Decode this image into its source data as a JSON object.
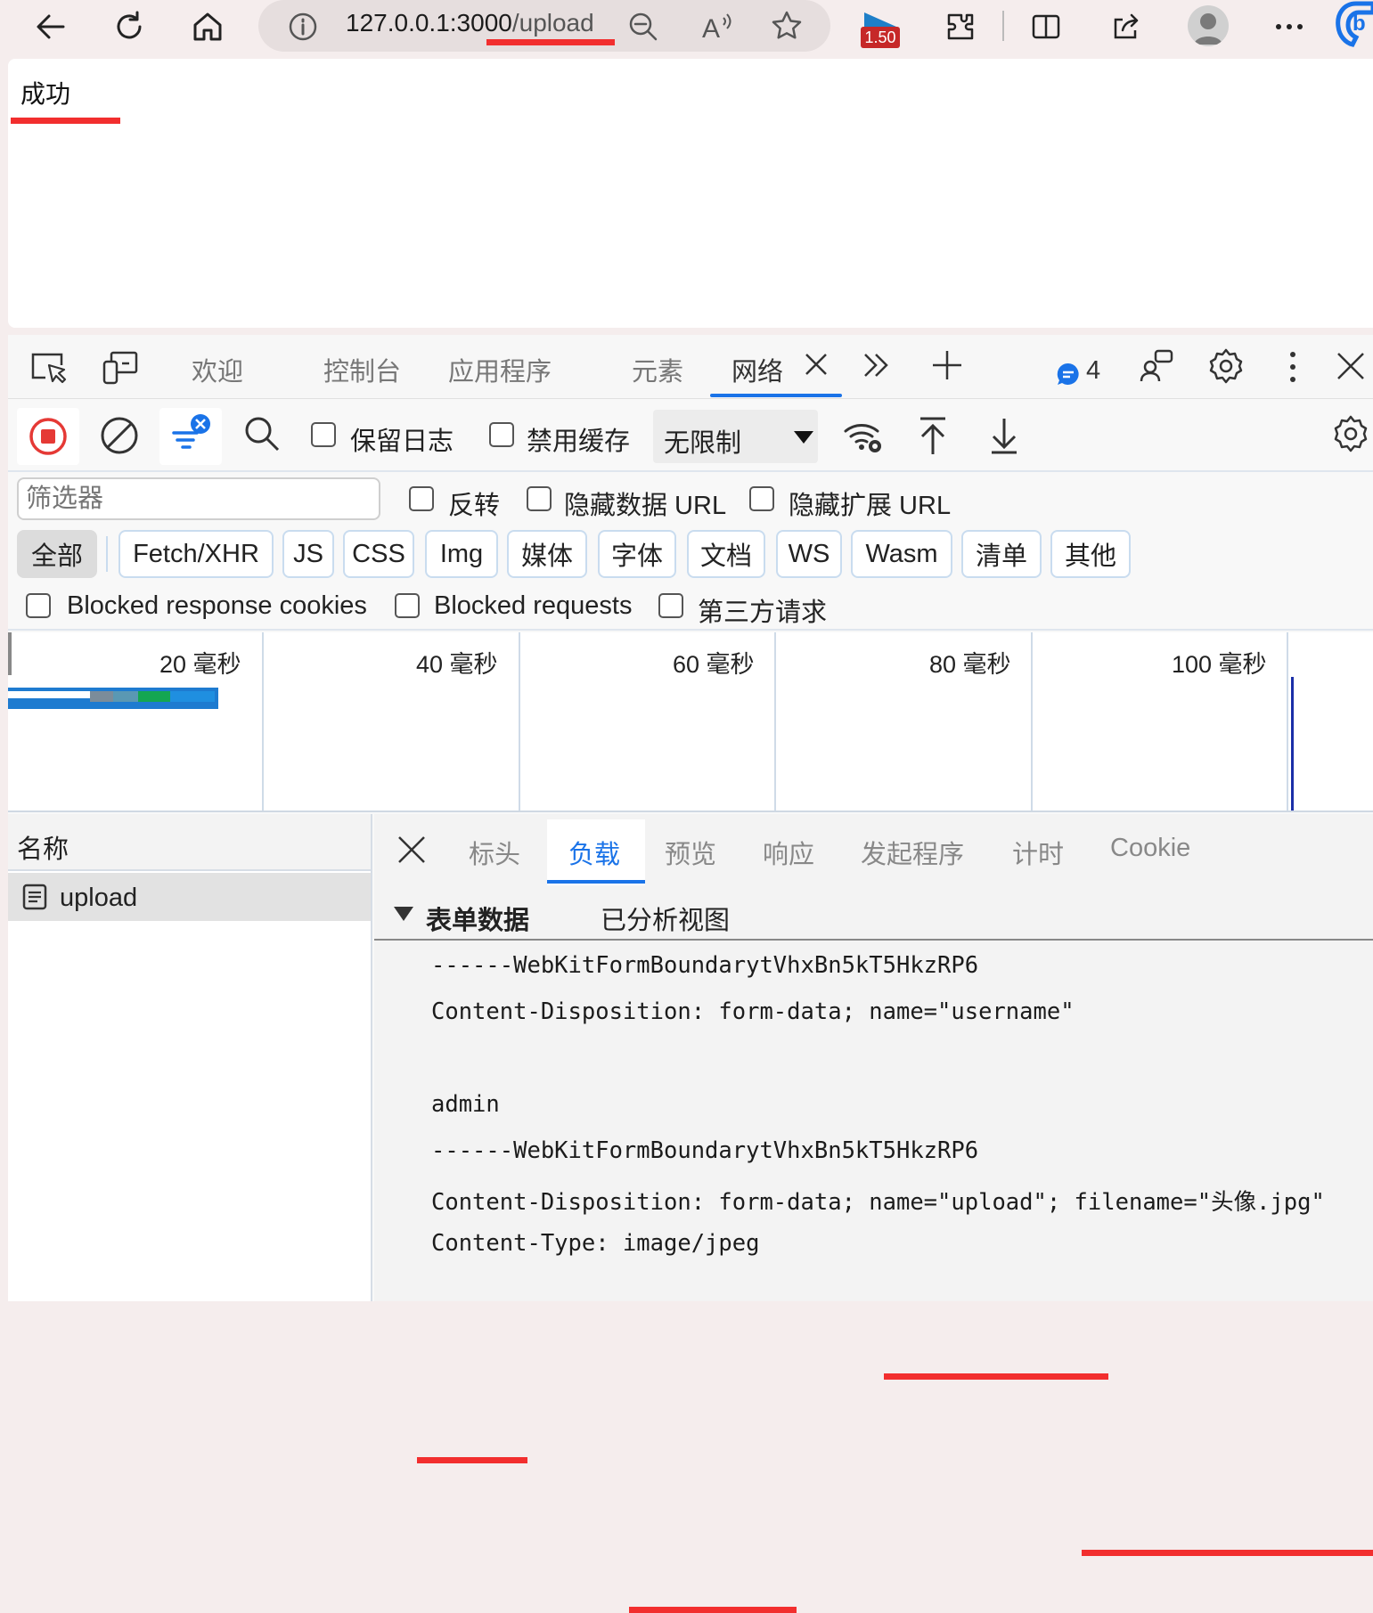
{
  "browser": {
    "url_host": "127.0.0.1:3000",
    "url_path": "/upload",
    "extension_badge": "1.50"
  },
  "page": {
    "text": "成功"
  },
  "devtools": {
    "tabs": [
      "欢迎",
      "控制台",
      "应用程序",
      "元素",
      "网络"
    ],
    "issues_count": "4",
    "toolbar": {
      "preserve_log": "保留日志",
      "disable_cache": "禁用缓存",
      "throttle_value": "无限制"
    },
    "filter": {
      "placeholder": "筛选器",
      "invert": "反转",
      "hide_data_urls": "隐藏数据 URL",
      "hide_extension_urls": "隐藏扩展 URL"
    },
    "type_filters": [
      "全部",
      "Fetch/XHR",
      "JS",
      "CSS",
      "Img",
      "媒体",
      "字体",
      "文档",
      "WS",
      "Wasm",
      "清单",
      "其他"
    ],
    "options": {
      "blocked_cookies": "Blocked response cookies",
      "blocked_requests": "Blocked requests",
      "third_party": "第三方请求"
    },
    "timeline_labels": [
      "20  毫秒",
      "40  毫秒",
      "60  毫秒",
      "80  毫秒",
      "100  毫秒"
    ],
    "name_column": "名称",
    "requests": [
      "upload"
    ],
    "detail_tabs": [
      "标头",
      "负载",
      "预览",
      "响应",
      "发起程序",
      "计时",
      "Cookie"
    ],
    "payload": {
      "section_title": "表单数据",
      "view_toggle": "已分析视图",
      "lines": [
        "------WebKitFormBoundarytVhxBn5kT5HkzRP6",
        "Content-Disposition: form-data; name=\"username\"",
        "",
        "admin",
        "------WebKitFormBoundarytVhxBn5kT5HkzRP6",
        "Content-Disposition: form-data; name=\"upload\"; filename=\"头像.jpg\"",
        "Content-Type: image/jpeg"
      ]
    }
  },
  "colors": {
    "accent": "#1a73e8",
    "annotation_red": "#f22e2e",
    "record_red": "#e53935"
  }
}
